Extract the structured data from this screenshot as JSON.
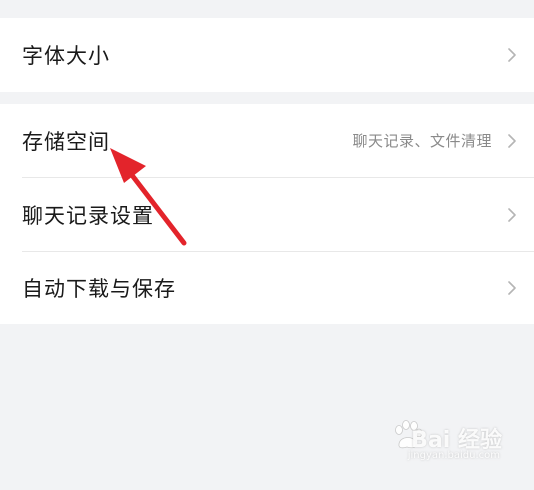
{
  "settings": {
    "group1": [
      {
        "label": "字体大小",
        "value": ""
      }
    ],
    "group2": [
      {
        "label": "存储空间",
        "value": "聊天记录、文件清理"
      },
      {
        "label": "聊天记录设置",
        "value": ""
      },
      {
        "label": "自动下载与保存",
        "value": ""
      }
    ]
  },
  "watermark": {
    "text": "Bai 经验",
    "url": "jingyan.baidu.com"
  },
  "colors": {
    "background": "#f2f3f5",
    "card": "#ffffff",
    "arrow": "#e3242b",
    "text": "#1a1a1a",
    "secondary_text": "#8a8a8a"
  },
  "icons": [
    "chevron-right-icon",
    "red-arrow-annotation",
    "baidu-paw-icon"
  ]
}
